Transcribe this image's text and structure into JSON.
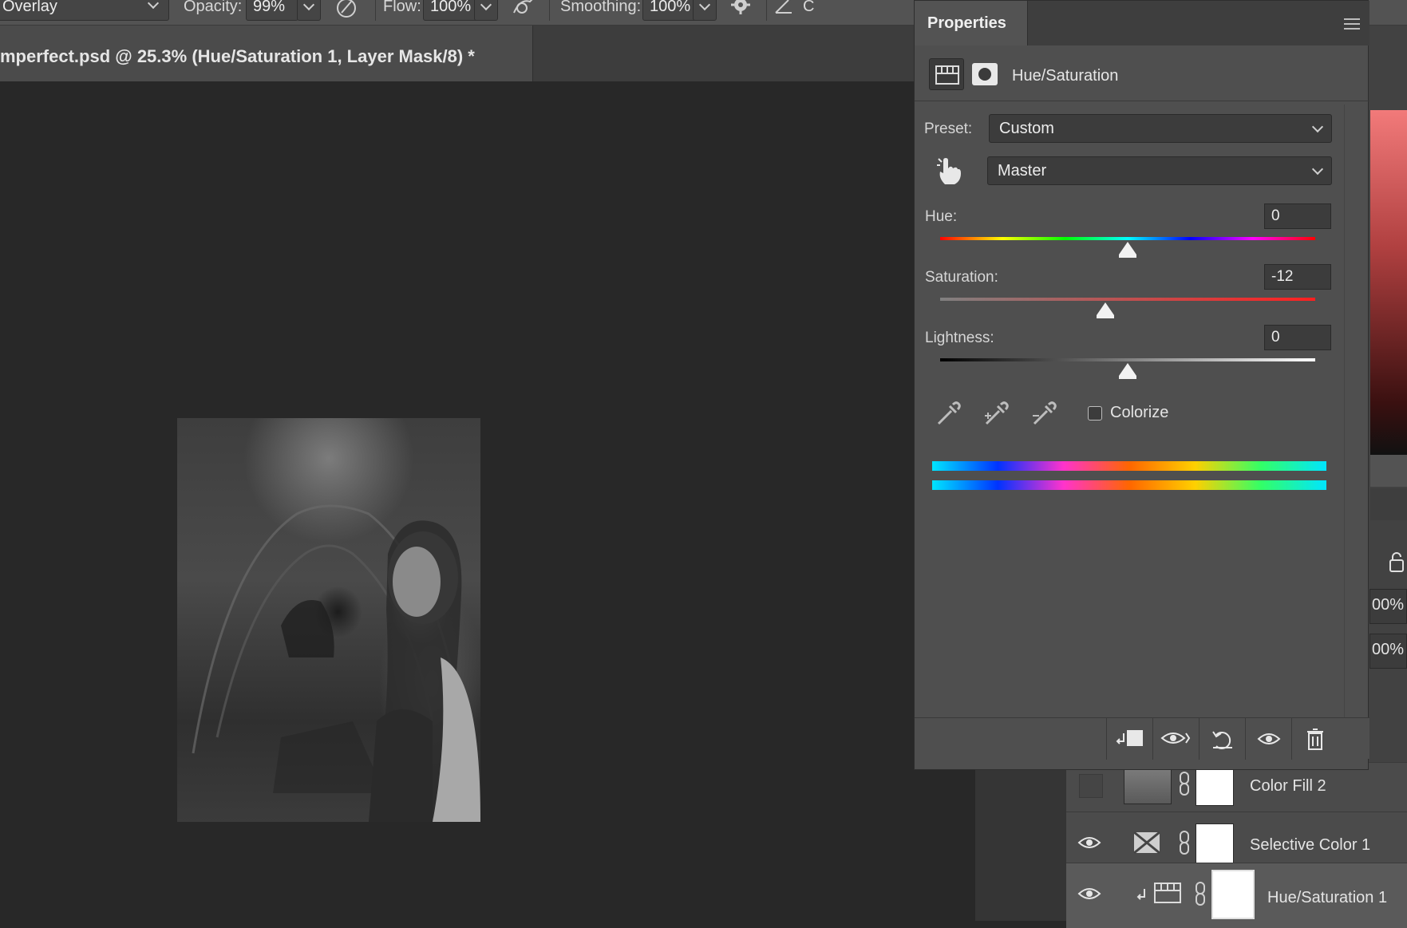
{
  "options_bar": {
    "mode_value": "Overlay",
    "opacity_label": "Opacity:",
    "opacity_value": "99%",
    "flow_label": "Flow:",
    "flow_value": "100%",
    "smoothing_label": "Smoothing:",
    "smoothing_value": "100%",
    "angle_partial": "C"
  },
  "document": {
    "tab_title": "mperfect.psd @ 25.3% (Hue/Saturation 1, Layer Mask/8) *"
  },
  "properties": {
    "panel_title": "Properties",
    "adjustment_name": "Hue/Saturation",
    "preset_label": "Preset:",
    "preset_value": "Custom",
    "channel_value": "Master",
    "hue_label": "Hue:",
    "hue_value": "0",
    "saturation_label": "Saturation:",
    "saturation_value": "-12",
    "lightness_label": "Lightness:",
    "lightness_value": "0",
    "colorize_label": "Colorize",
    "colorize_checked": false
  },
  "layers": {
    "items": [
      {
        "name": "Color Fill 2",
        "visible": false
      },
      {
        "name": "Selective Color 1",
        "visible": true
      },
      {
        "name": "Hue/Saturation 1",
        "visible": true
      }
    ],
    "opacity_partial": "00%",
    "fill_partial": "00%"
  },
  "icons": [
    "brush-settings-icon",
    "airbrush-icon",
    "gear-icon",
    "angle-icon",
    "panel-menu-icon",
    "adjustment-icon",
    "mask-icon",
    "target-adjust-hand-icon",
    "eyedropper-icon",
    "eyedropper-plus-icon",
    "eyedropper-minus-icon",
    "clip-to-layer-icon",
    "view-previous-icon",
    "reset-icon",
    "visibility-eye-icon",
    "trash-icon",
    "lock-icon",
    "link-icon"
  ],
  "colors": {
    "panel_bg": "#4f4f4f",
    "canvas_bg": "#282828",
    "toolbar_bg": "#535353"
  }
}
